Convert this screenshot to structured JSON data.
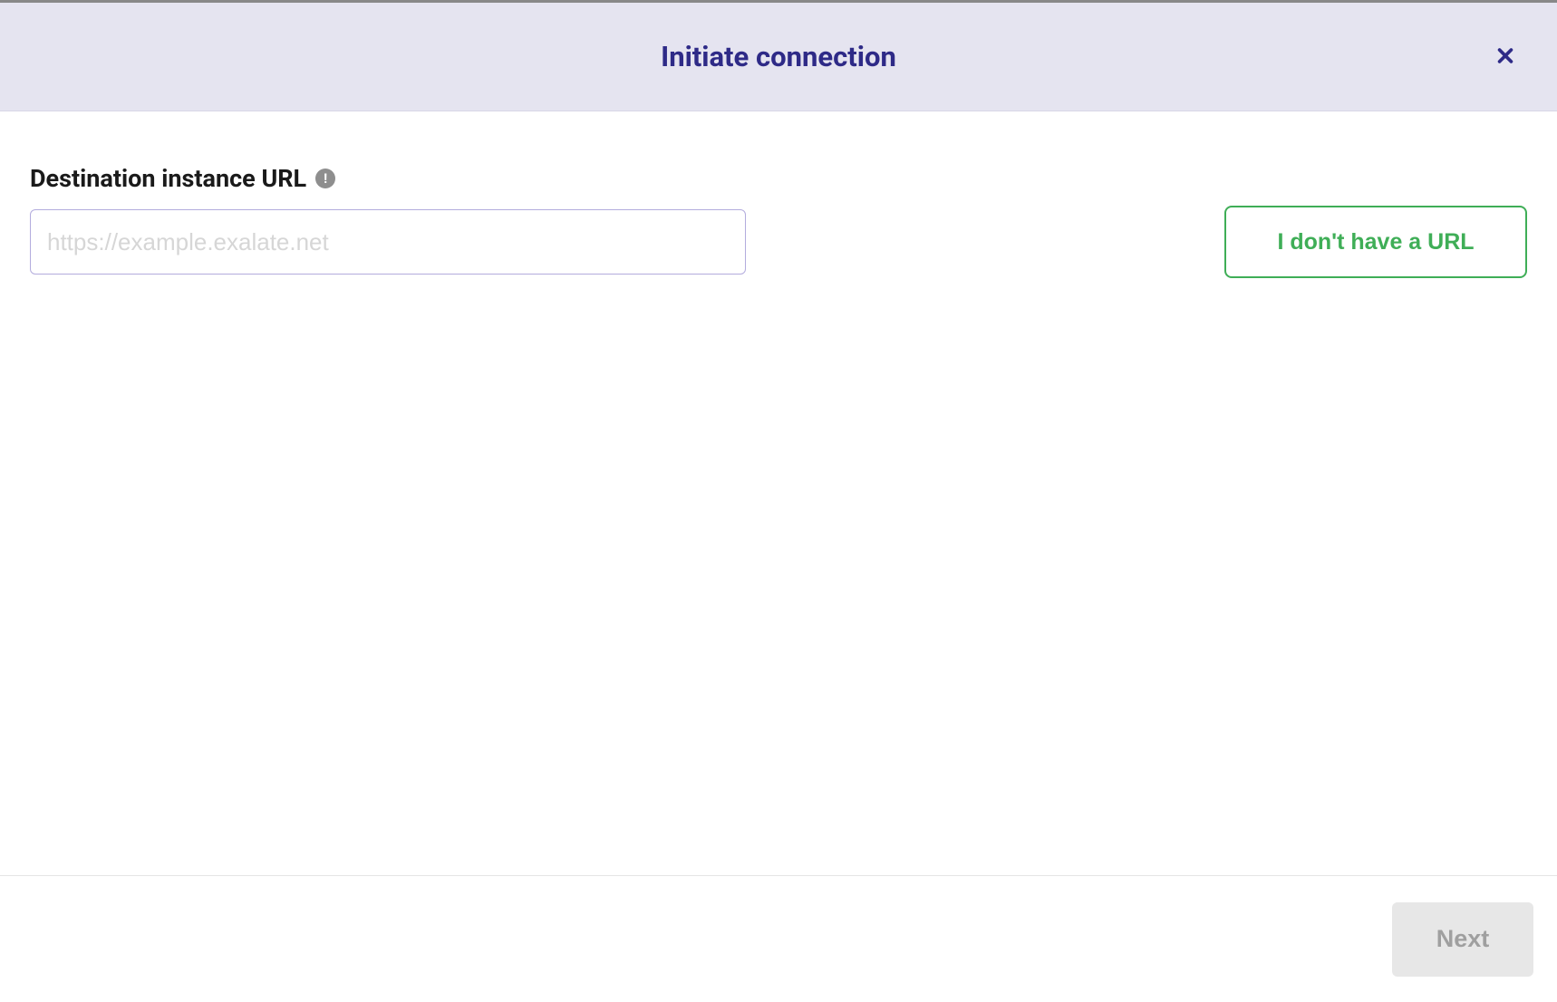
{
  "header": {
    "title": "Initiate connection"
  },
  "form": {
    "url_field": {
      "label": "Destination instance URL",
      "placeholder": "https://example.exalate.net",
      "value": ""
    },
    "no_url_button_label": "I don't have a URL"
  },
  "footer": {
    "next_button_label": "Next"
  }
}
